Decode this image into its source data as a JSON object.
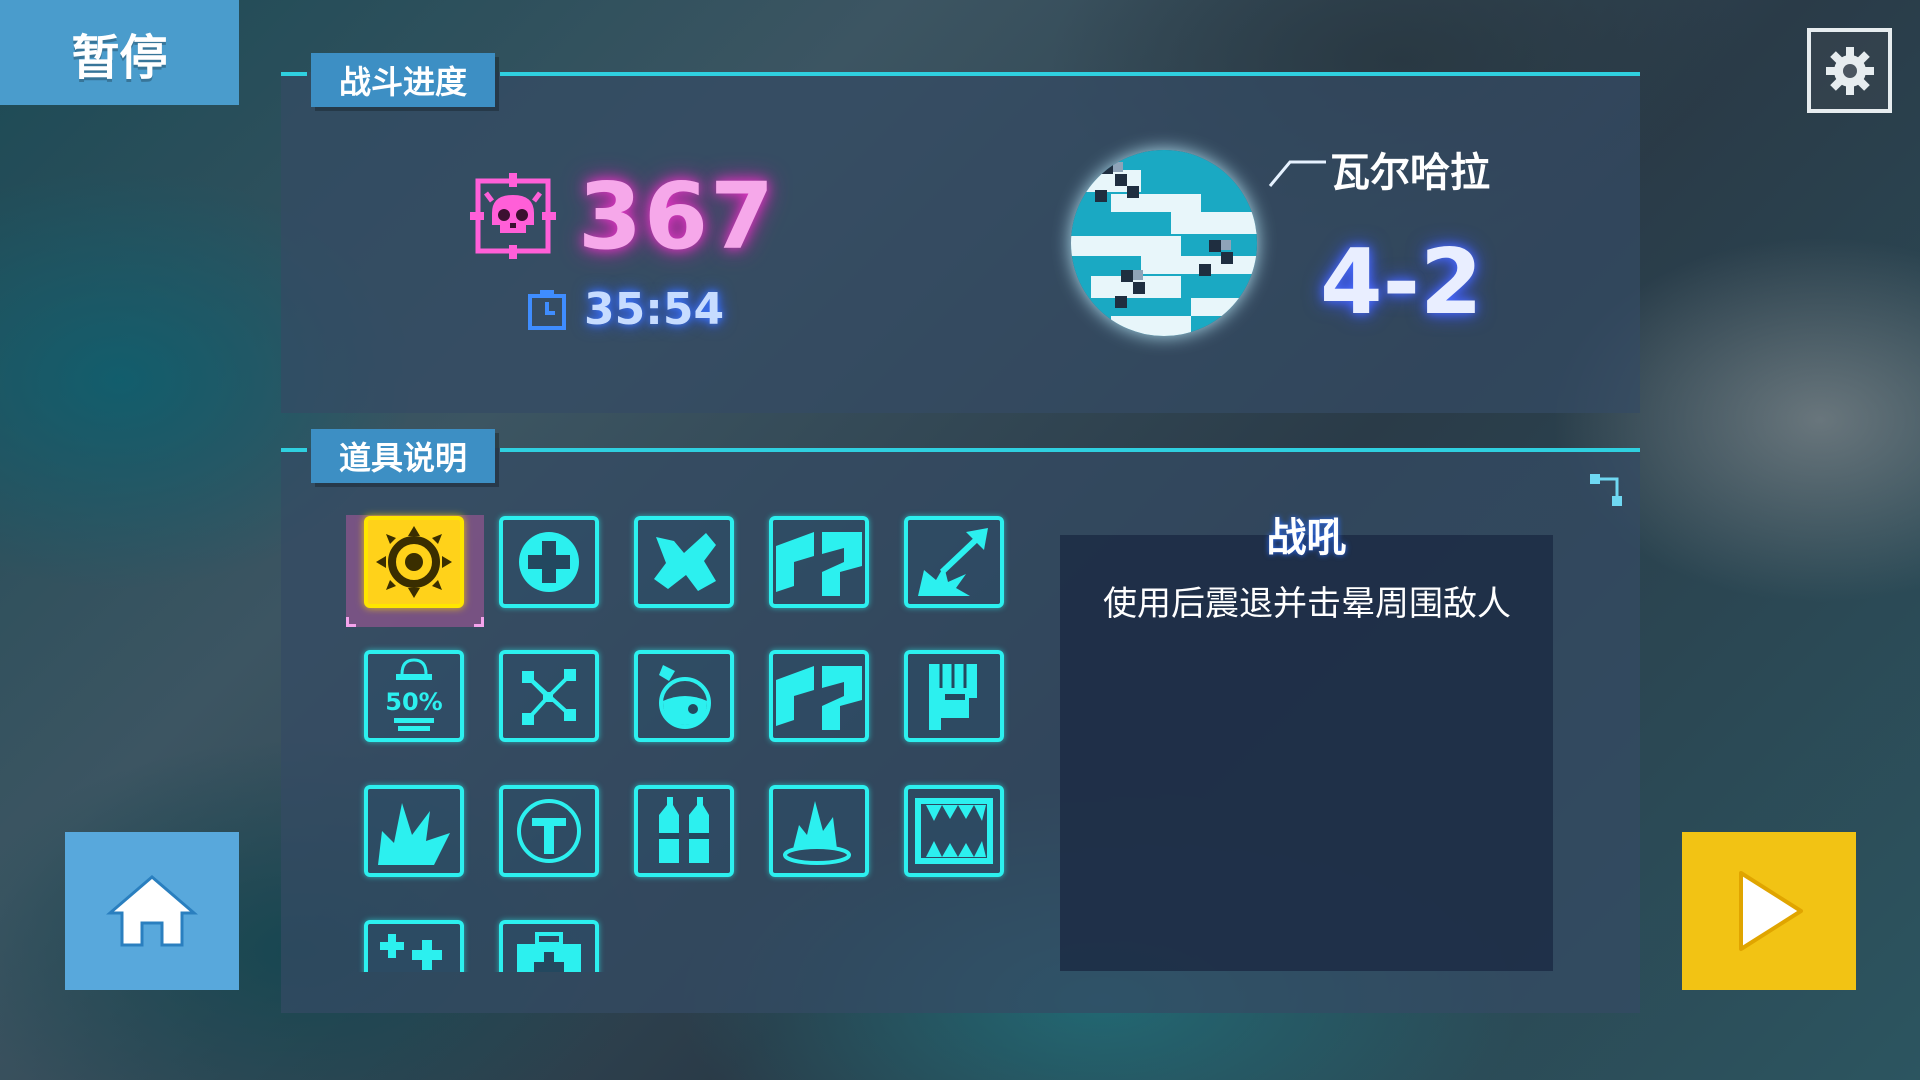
{
  "pause": {
    "label": "暂停"
  },
  "progress": {
    "tab_label": "战斗进度",
    "kills": "367",
    "time": "35:54",
    "stage_name": "瓦尔哈拉",
    "stage_level": "4-2"
  },
  "items": {
    "tab_label": "道具说明",
    "selected_index": 0,
    "icons": [
      "warcry-icon",
      "health-cross-icon",
      "blob-icon",
      "dash-icon",
      "arrow-burst-icon",
      "half-price-icon",
      "network-icon",
      "potion-icon",
      "dash-icon",
      "fist-icon",
      "explosion-icon",
      "shield-cross-icon",
      "bottles-icon",
      "flame-ground-icon",
      "fangs-icon",
      "sparkle-plus-icon",
      "medkit-icon"
    ],
    "half_price_text": "50%",
    "selected_title": "战吼",
    "selected_desc": "使用后震退并击晕周围敌人"
  },
  "colors": {
    "accent_cyan": "#2cf0ef",
    "kills_pink": "#f6a8ea",
    "selected_yellow": "#ffd21a",
    "pause_blue": "#4a9ccc",
    "play_yellow": "#f2c314"
  }
}
